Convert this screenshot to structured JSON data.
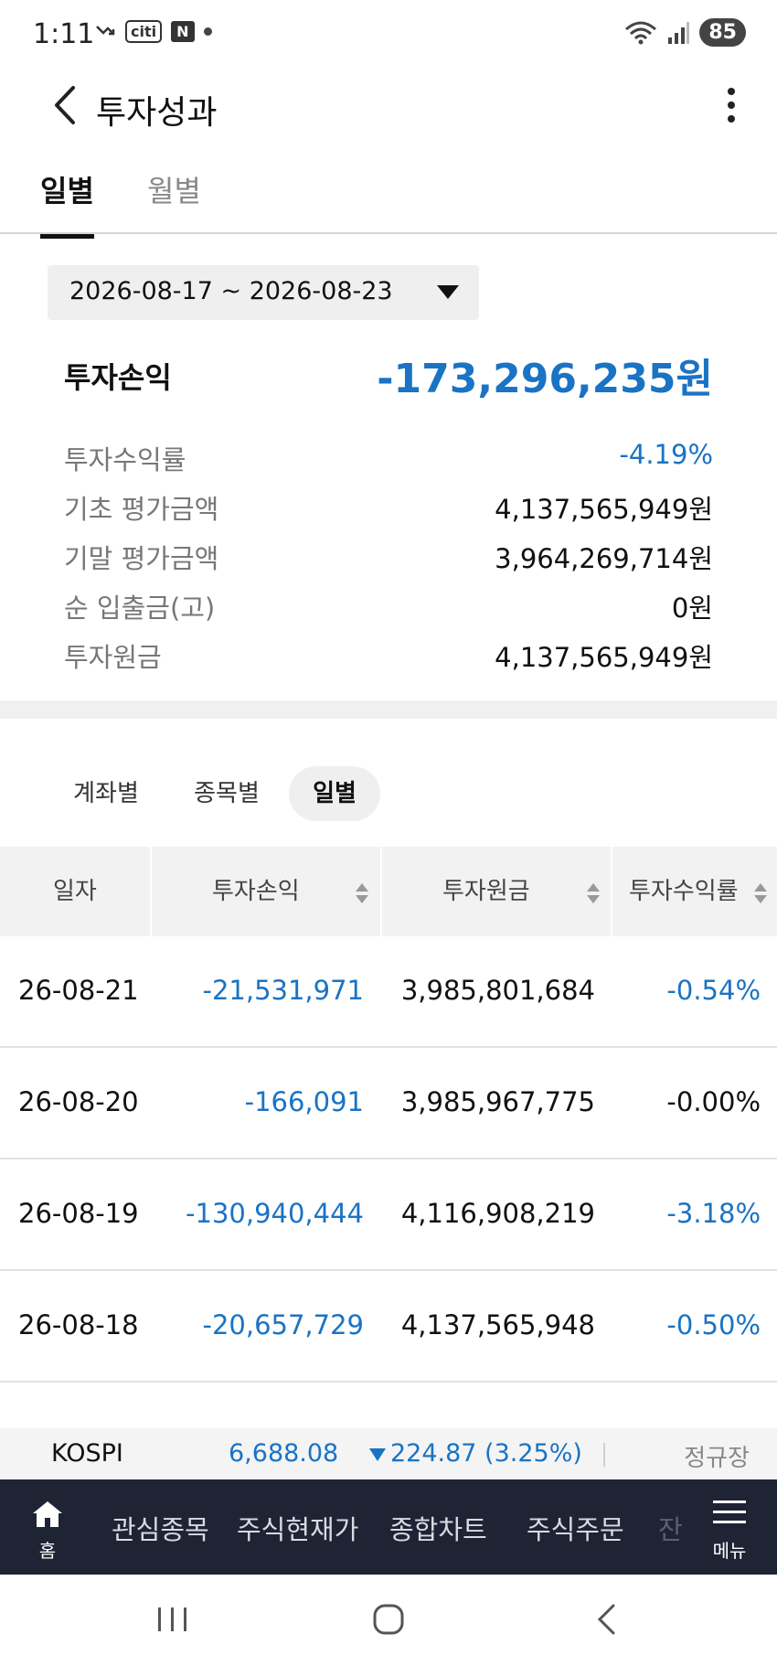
{
  "status_bar": {
    "time": "1:11",
    "carrier_badge": "citi",
    "app_badge": "N",
    "battery": "85"
  },
  "header": {
    "title": "투자성과"
  },
  "period_tabs": [
    {
      "label": "일별",
      "active": true
    },
    {
      "label": "월별",
      "active": false
    }
  ],
  "date_range": "2026-08-17 ~ 2026-08-23",
  "summary": {
    "main_label": "투자손익",
    "main_value": "-173,296,235원",
    "rows": [
      {
        "label": "투자수익률",
        "value": "-4.19%"
      },
      {
        "label": "기초 평가금액",
        "value": "4,137,565,949원"
      },
      {
        "label": "기말 평가금액",
        "value": "3,964,269,714원"
      },
      {
        "label": "순 입출금(고)",
        "value": "0원"
      },
      {
        "label": "투자원금",
        "value": "4,137,565,949원"
      }
    ]
  },
  "view_chips": [
    {
      "label": "계좌별",
      "active": false
    },
    {
      "label": "종목별",
      "active": false
    },
    {
      "label": "일별",
      "active": true
    }
  ],
  "table": {
    "columns": [
      "일자",
      "투자손익",
      "투자원금",
      "투자수익률"
    ],
    "rows": [
      {
        "date": "26-08-21",
        "profit": "-21,531,971",
        "principal": "3,985,801,684",
        "rate": "-0.54%"
      },
      {
        "date": "26-08-20",
        "profit": "-166,091",
        "principal": "3,985,967,775",
        "rate": "-0.00%"
      },
      {
        "date": "26-08-19",
        "profit": "-130,940,444",
        "principal": "4,116,908,219",
        "rate": "-3.18%"
      },
      {
        "date": "26-08-18",
        "profit": "-20,657,729",
        "principal": "4,137,565,948",
        "rate": "-0.50%"
      }
    ]
  },
  "ticker": {
    "name": "KOSPI",
    "value": "6,688.08",
    "change": "224.87 (3.25%)",
    "session": "정규장"
  },
  "bottom_nav": {
    "home_label": "홈",
    "items": [
      "관심종목",
      "주식현재가",
      "종합차트",
      "주식주문",
      "잔"
    ],
    "menu_label": "메뉴"
  },
  "colors": {
    "accent_blue": "#1a73c4",
    "nav_bg": "#1e2434"
  }
}
